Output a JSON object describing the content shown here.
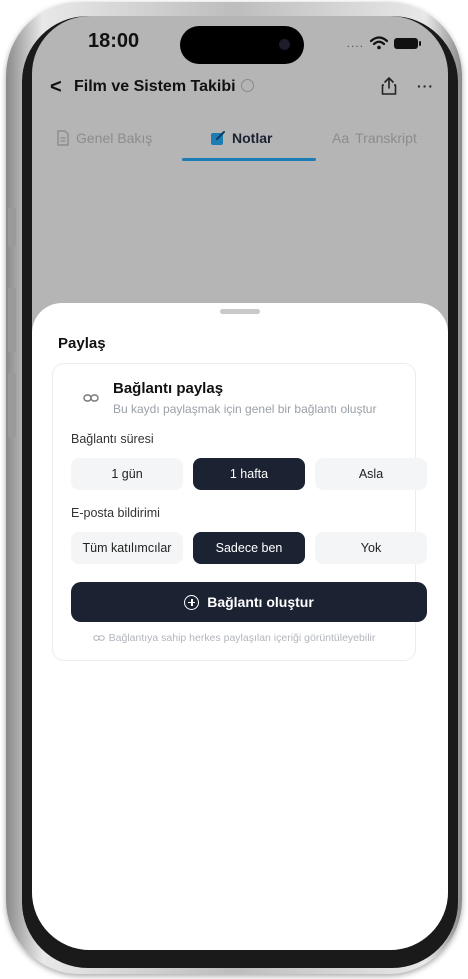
{
  "status_bar": {
    "time": "18:00"
  },
  "nav": {
    "title": "Film ve Sistem Takibi",
    "back_glyph": "<",
    "more_glyph": "···"
  },
  "tabs": [
    {
      "label": "Genel Bakış",
      "active": false,
      "icon": "document-icon"
    },
    {
      "label": "Notlar",
      "active": true,
      "icon": "notes-icon"
    },
    {
      "label": "Transkript",
      "active": false,
      "icon": "text-icon",
      "icon_text": "Aa"
    }
  ],
  "share_sheet": {
    "title": "Paylaş",
    "heading": "Bağlantı paylaş",
    "description": "Bu kaydı paylaşmak için genel bir bağlantı oluştur",
    "duration_label": "Bağlantı süresi",
    "duration_options": [
      "1 gün",
      "1 hafta",
      "Asla"
    ],
    "duration_selected": "1 hafta",
    "email_label": "E-posta bildirimi",
    "email_options": [
      "Tüm katılımcılar",
      "Sadece ben",
      "Yok"
    ],
    "email_selected": "Sadece ben",
    "create_button": "Bağlantı oluştur",
    "footnote": "Bağlantıya sahip herkes paylaşılan içeriği görüntüleyebilir"
  },
  "colors": {
    "accent": "#1b2232",
    "tab_indicator": "#1c7db4",
    "dim_overlay": "#b5b5b5"
  }
}
